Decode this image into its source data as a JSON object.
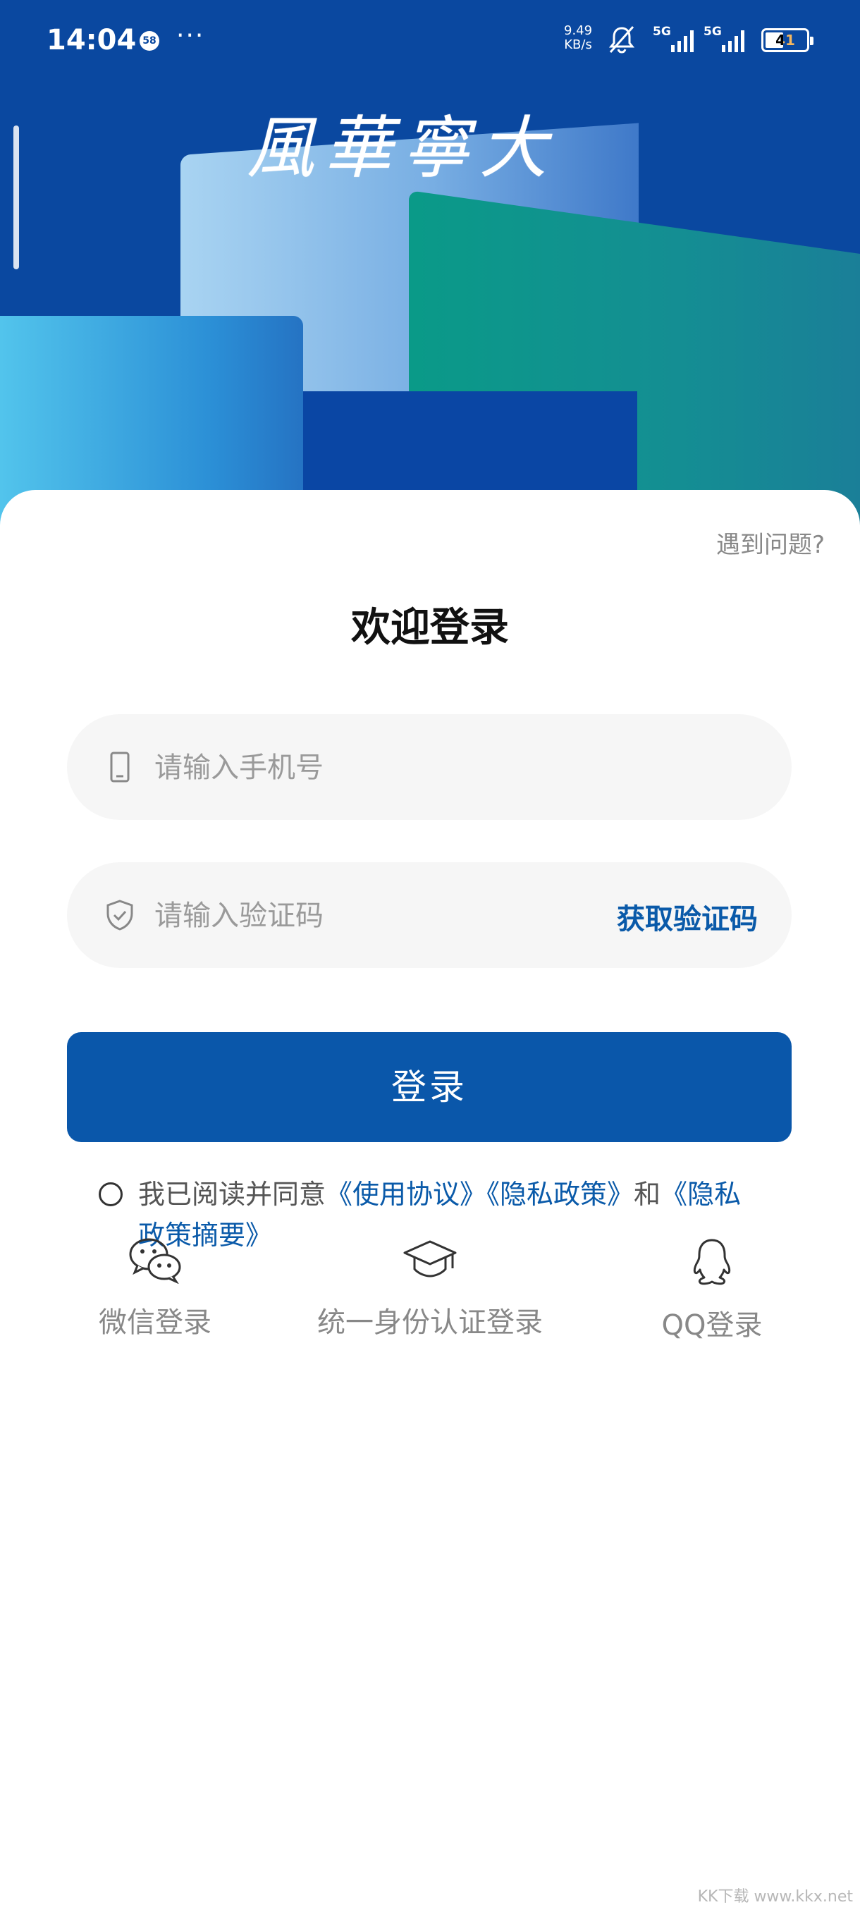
{
  "status_bar": {
    "time": "14:04",
    "notification_count": "58",
    "more": "···",
    "net_speed_value": "9.49",
    "net_speed_unit": "KB/s",
    "signal1": "5G",
    "signal2": "5G",
    "battery": "41"
  },
  "header": {
    "calligraphy": "風華寧大"
  },
  "login": {
    "help_link": "遇到问题?",
    "title": "欢迎登录",
    "phone_placeholder": "请输入手机号",
    "code_placeholder": "请输入验证码",
    "get_code": "获取验证码",
    "submit": "登录",
    "agreement_prefix": "我已阅读并同意",
    "terms_link": "《使用协议》",
    "privacy_link": "《隐私政策》",
    "and": "和",
    "privacy_summary_link": "《隐私政策摘要》"
  },
  "alt_logins": [
    {
      "label": "微信登录",
      "icon": "wechat-icon"
    },
    {
      "label": "统一身份认证登录",
      "icon": "graduation-cap-icon"
    },
    {
      "label": "QQ登录",
      "icon": "qq-icon"
    }
  ],
  "watermark": "KK下载 www.kkx.net",
  "colors": {
    "primary": "#0a57aa",
    "header_bg": "#0a48a0",
    "link": "#0a5aa9",
    "field_bg": "#f6f6f6"
  }
}
